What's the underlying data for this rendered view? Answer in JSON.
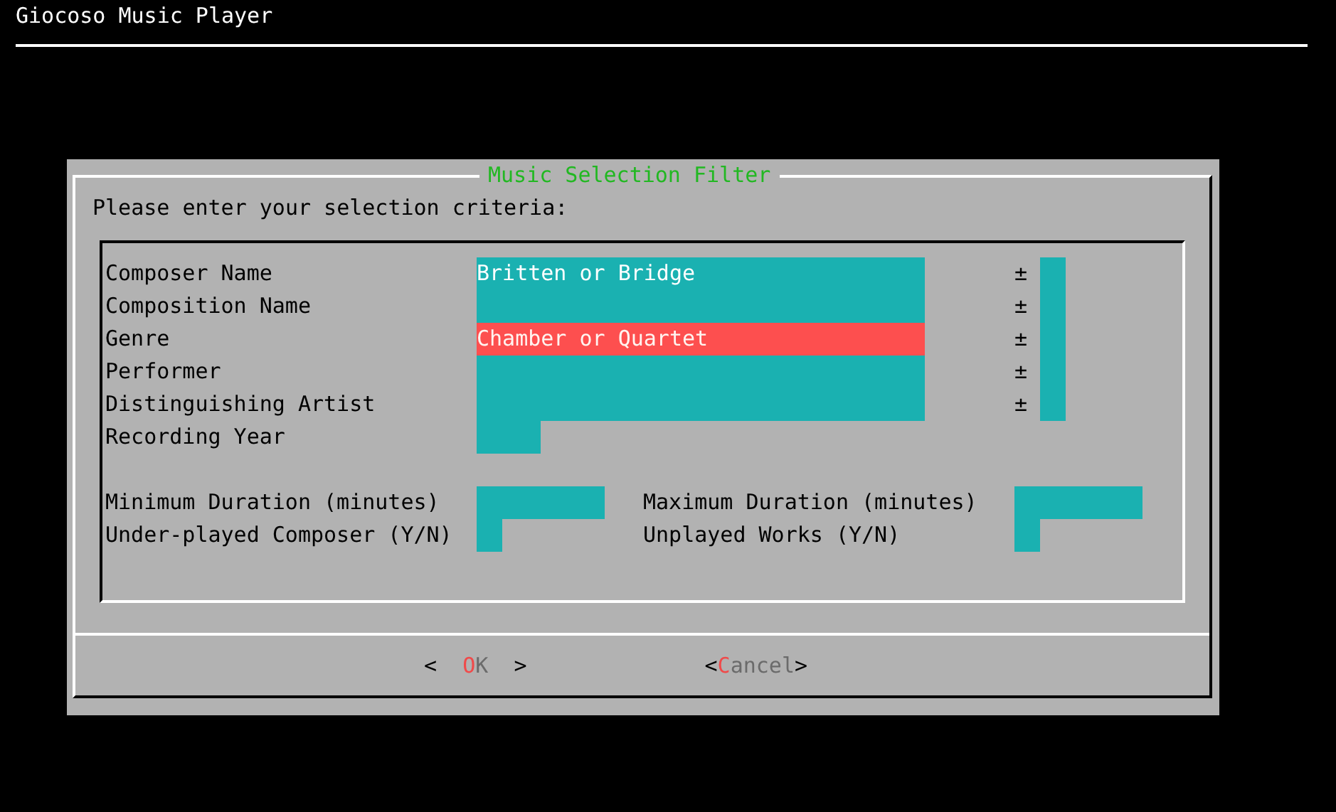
{
  "app_title": "Giocoso Music Player",
  "dialog": {
    "title": "Music Selection Filter",
    "prompt": "Please enter your selection criteria:",
    "rows": [
      {
        "label": "Composer Name",
        "value": "Britten or Bridge",
        "kind": "long",
        "selected": false,
        "marker": "±"
      },
      {
        "label": "Composition Name",
        "kind": "long",
        "selected": false,
        "marker": "±"
      },
      {
        "label": "Genre",
        "value": "Chamber or Quartet",
        "kind": "long",
        "selected": true,
        "marker": "±"
      },
      {
        "label": "Performer",
        "kind": "long",
        "selected": false,
        "marker": "±"
      },
      {
        "label": "Distinguishing Artist",
        "kind": "long",
        "selected": false,
        "marker": "±"
      },
      {
        "label": "Recording Year",
        "kind": "short",
        "selected": false
      }
    ],
    "pairs": [
      [
        {
          "label": "Minimum Duration (minutes)",
          "kind": "number"
        },
        {
          "label": "Maximum Duration (minutes)",
          "kind": "number"
        }
      ],
      [
        {
          "label": "Under-played Composer (Y/N)",
          "kind": "flag"
        },
        {
          "label": "Unplayed Works (Y/N)",
          "kind": "flag"
        }
      ]
    ],
    "buttons": [
      {
        "text": "<  OK  >"
      },
      {
        "text": "<Cancel>"
      }
    ]
  }
}
